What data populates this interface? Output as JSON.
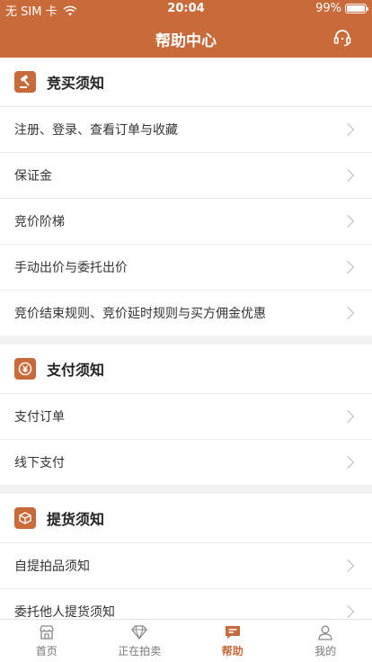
{
  "status": {
    "carrier": "无 SIM 卡",
    "time": "20:04",
    "battery": "99%",
    "battery_level": 0.99
  },
  "nav": {
    "title": "帮助中心"
  },
  "sections": [
    {
      "title": "竞买须知",
      "items": [
        "注册、登录、查看订单与收藏",
        "保证金",
        "竞价阶梯",
        "手动出价与委托出价",
        "竞价结束规则、竞价延时规则与买方佣金优惠"
      ]
    },
    {
      "title": "支付须知",
      "items": [
        "支付订单",
        "线下支付"
      ]
    },
    {
      "title": "提货须知",
      "items": [
        "自提拍品须知",
        "委托他人提货须知"
      ]
    }
  ],
  "tabs": [
    {
      "label": "首页",
      "icon": "store-icon"
    },
    {
      "label": "正在拍卖",
      "icon": "diamond-icon"
    },
    {
      "label": "帮助",
      "icon": "help-chat-icon",
      "active": true
    },
    {
      "label": "我的",
      "icon": "user-icon"
    }
  ],
  "colors": {
    "accent": "#c96a3b",
    "background": "#f2f2f2"
  }
}
